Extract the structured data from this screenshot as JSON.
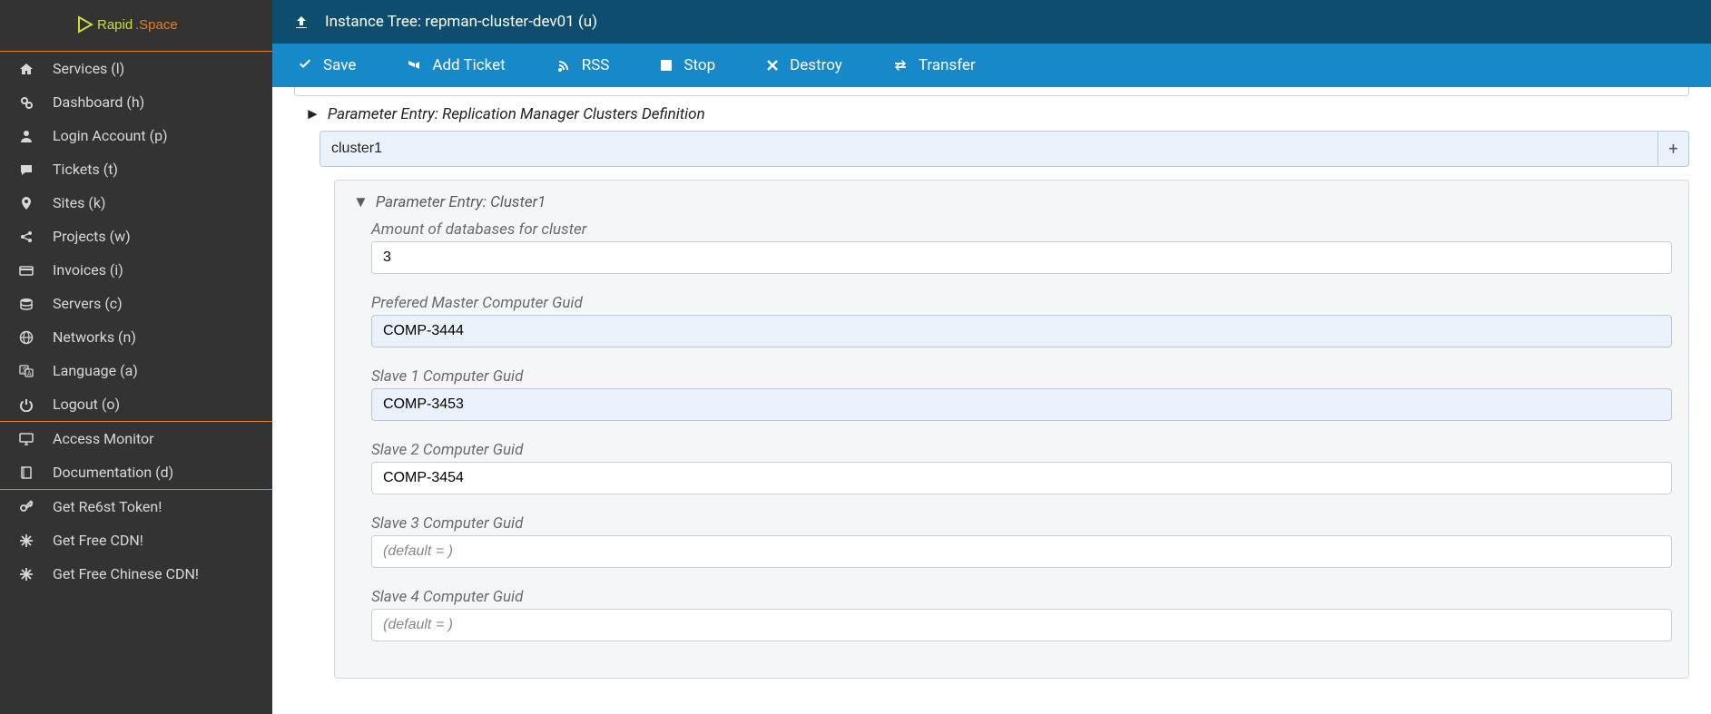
{
  "logo": {
    "text1": "Rapid",
    "text2": ".Space"
  },
  "header": {
    "title": "Instance Tree: repman-cluster-dev01 (u)"
  },
  "toolbar": {
    "save": "Save",
    "add_ticket": "Add Ticket",
    "rss": "RSS",
    "stop": "Stop",
    "destroy": "Destroy",
    "transfer": "Transfer"
  },
  "sidebar": {
    "main": [
      {
        "label": "Services (l)",
        "icon": "home"
      },
      {
        "label": "Dashboard (h)",
        "icon": "gears"
      },
      {
        "label": "Login Account (p)",
        "icon": "user"
      },
      {
        "label": "Tickets (t)",
        "icon": "comment"
      },
      {
        "label": "Sites (k)",
        "icon": "marker"
      },
      {
        "label": "Projects (w)",
        "icon": "share"
      },
      {
        "label": "Invoices (i)",
        "icon": "card"
      },
      {
        "label": "Servers (c)",
        "icon": "db"
      },
      {
        "label": "Networks (n)",
        "icon": "globe"
      },
      {
        "label": "Language (a)",
        "icon": "lang"
      },
      {
        "label": "Logout (o)",
        "icon": "power"
      }
    ],
    "mid": [
      {
        "label": "Access Monitor",
        "icon": "monitor"
      },
      {
        "label": "Documentation (d)",
        "icon": "book"
      }
    ],
    "bottom": [
      {
        "label": "Get Re6st Token!",
        "icon": "key"
      },
      {
        "label": "Get Free CDN!",
        "icon": "star"
      },
      {
        "label": "Get Free Chinese CDN!",
        "icon": "star"
      }
    ]
  },
  "section_outer": {
    "title": "Parameter Entry: Replication Manager Clusters Definition",
    "cluster_name": "cluster1"
  },
  "section_inner": {
    "title": "Parameter Entry: Cluster1",
    "fields": [
      {
        "label": "Amount of databases for cluster",
        "value": "3",
        "placeholder": "",
        "highlight": false
      },
      {
        "label": "Prefered Master Computer Guid",
        "value": "COMP-3444",
        "placeholder": "",
        "highlight": true
      },
      {
        "label": "Slave 1 Computer Guid",
        "value": "COMP-3453",
        "placeholder": "",
        "highlight": true
      },
      {
        "label": "Slave 2 Computer Guid",
        "value": "COMP-3454",
        "placeholder": "",
        "highlight": false
      },
      {
        "label": "Slave 3 Computer Guid",
        "value": "",
        "placeholder": "(default = )",
        "highlight": false
      },
      {
        "label": "Slave 4 Computer Guid",
        "value": "",
        "placeholder": "(default = )",
        "highlight": false
      }
    ]
  }
}
